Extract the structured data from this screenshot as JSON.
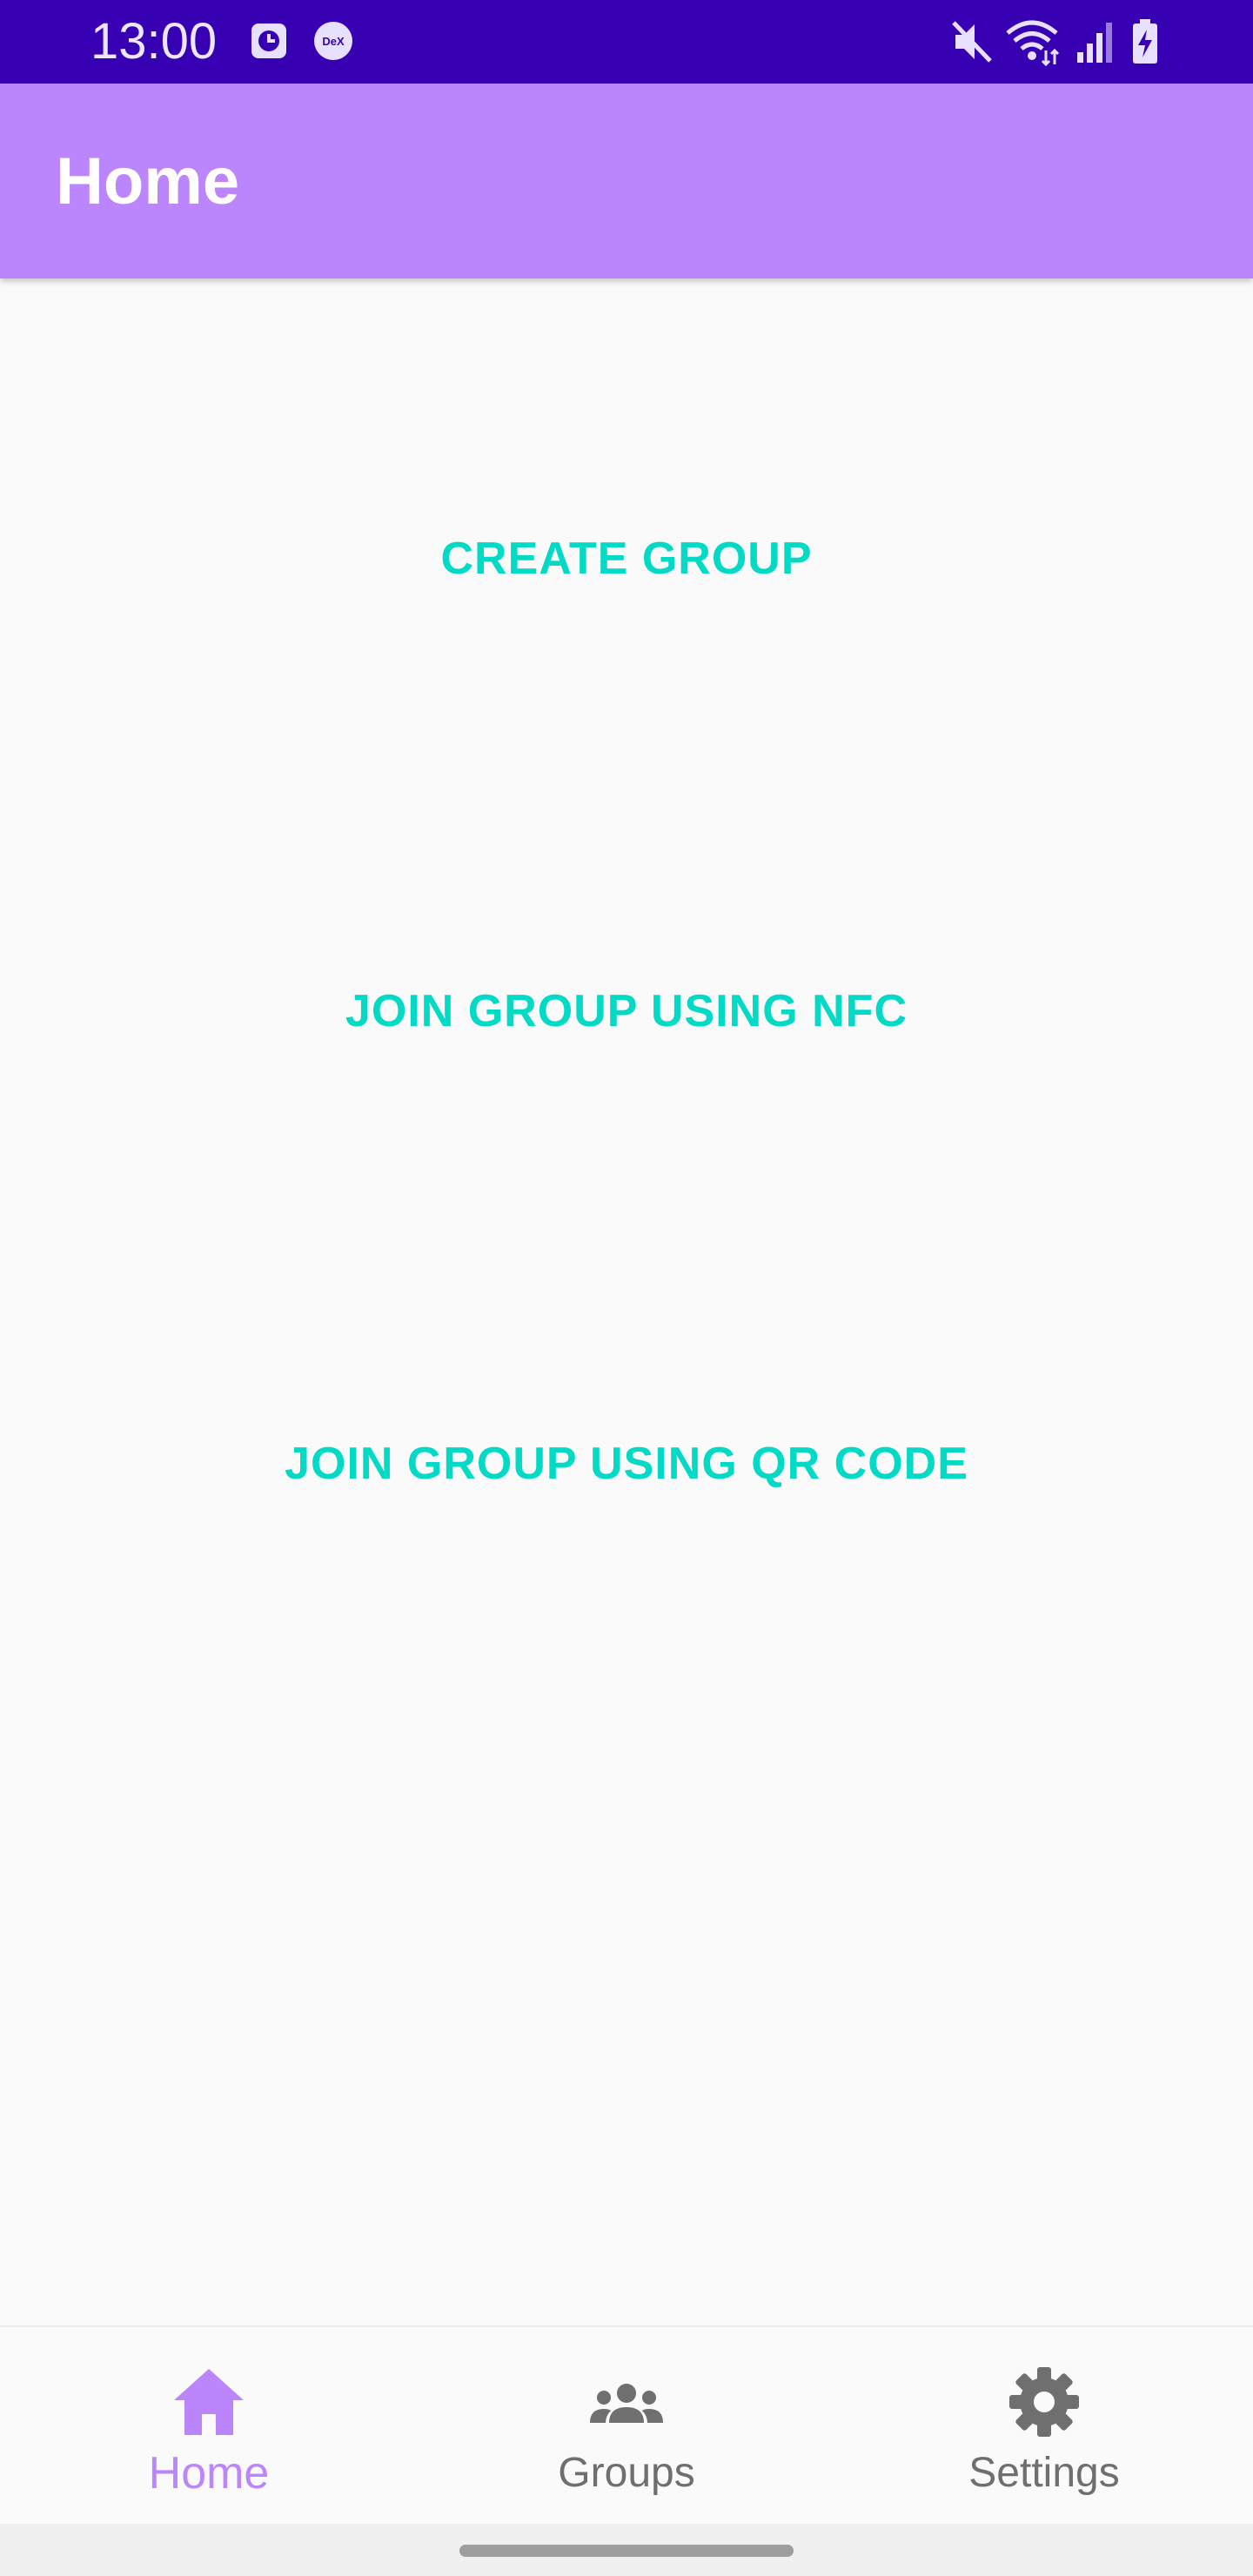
{
  "status_bar": {
    "time": "13:00",
    "left_icons": [
      "clock-notification-icon",
      "dex-icon"
    ],
    "dex_text": "DeX",
    "right_icons": [
      "mute-icon",
      "wifi-icon",
      "signal-icon",
      "battery-charging-icon"
    ],
    "background": "#3700b3"
  },
  "app_bar": {
    "title": "Home",
    "background": "#bb86fc"
  },
  "actions": {
    "create_group": "CREATE GROUP",
    "join_nfc": "JOIN GROUP USING NFC",
    "join_qr": "JOIN GROUP USING QR CODE",
    "color": "#03dac5"
  },
  "bottom_nav": {
    "items": [
      {
        "label": "Home",
        "icon": "home-icon",
        "active": true
      },
      {
        "label": "Groups",
        "icon": "groups-icon",
        "active": false
      },
      {
        "label": "Settings",
        "icon": "gear-icon",
        "active": false
      }
    ],
    "active_color": "#bb86fc",
    "inactive_color": "#6f6f6f"
  }
}
